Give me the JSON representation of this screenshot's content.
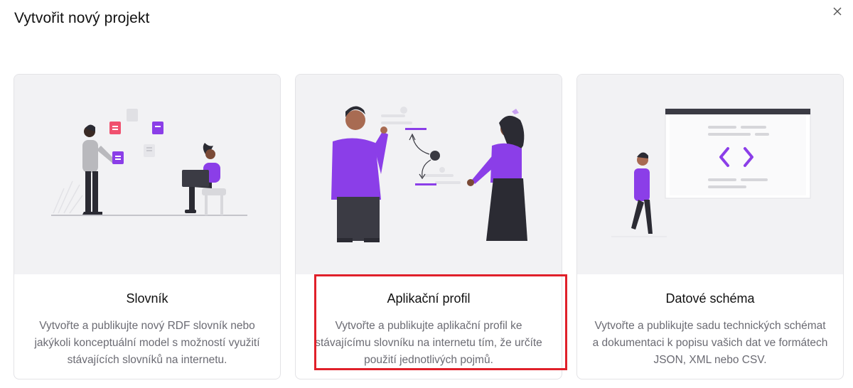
{
  "dialog": {
    "title": "Vytvořit nový projekt",
    "close_icon": "close-icon"
  },
  "cards": [
    {
      "title": "Slovník",
      "description": "Vytvořte a publikujte nový RDF slovník nebo jakýkoli konceptuální model s možností využití stávajících slovníků na internetu.",
      "illustration": "person-with-notes-illustration"
    },
    {
      "title": "Aplikační profil",
      "description": "Vytvořte a publikujte aplikační profil ke stávajícímu slovníku na internetu tím, že určíte použití jednotlivých pojmů.",
      "illustration": "two-people-diagram-illustration"
    },
    {
      "title": "Datové schéma",
      "description": "Vytvořte a publikujte sadu technických schémat a dokumentaci k popisu vašich dat ve formátech JSON, XML nebo CSV.",
      "illustration": "person-code-window-illustration"
    }
  ],
  "colors": {
    "accent": "#8b3ee8",
    "pink": "#f0506e",
    "highlight": "#e0202a",
    "illustration_bg": "#f2f2f4"
  }
}
